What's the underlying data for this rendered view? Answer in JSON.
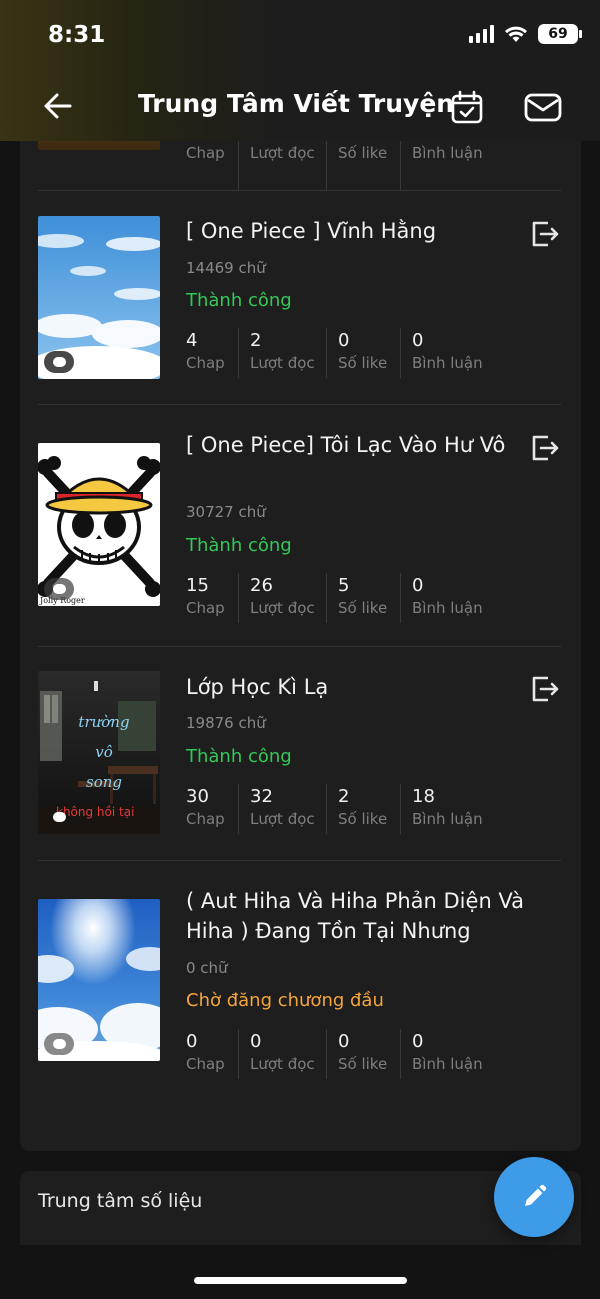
{
  "status": {
    "time": "8:31",
    "battery": "69"
  },
  "header": {
    "title": "Trung Tâm Viết Truyện"
  },
  "stat_labels": {
    "chap": "Chap",
    "views": "Lượt đọc",
    "likes": "Số like",
    "comments": "Bình luận"
  },
  "stories": [
    {
      "title": "[ One Piece ] Vĩnh Hằng",
      "words": "14469 chữ",
      "status": "Thành công",
      "chap": "4",
      "views": "2",
      "likes": "0",
      "comments": "0"
    },
    {
      "title": "[ One Piece] Tôi Lạc Vào Hư Vô",
      "words": "30727 chữ",
      "status": "Thành công",
      "chap": "15",
      "views": "26",
      "likes": "5",
      "comments": "0",
      "cover_caption": "Jolly Roger"
    },
    {
      "title": "Lớp Học Kì Lạ",
      "words": "19876 chữ",
      "status": "Thành công",
      "chap": "30",
      "views": "32",
      "likes": "2",
      "comments": "18",
      "cover_text": [
        "trường",
        "vô",
        "song"
      ],
      "cover_caption": "không hồi tại"
    },
    {
      "title": "( Aut Hiha Và Hiha Phản Diện Và Hiha ) Đang Tồn Tại Nhưng",
      "words": "0 chữ",
      "status": "Chờ đăng chương đầu",
      "chap": "0",
      "views": "0",
      "likes": "0",
      "comments": "0"
    }
  ],
  "section2": {
    "title": "Trung tâm số liệu"
  },
  "colors": {
    "success": "#34c759",
    "pending": "#f4a53c",
    "fab": "#3d9be8"
  },
  "icons": [
    "back-arrow-icon",
    "calendar-check-icon",
    "mail-icon",
    "exit-icon",
    "comment-bubble-icon",
    "pencil-icon"
  ]
}
